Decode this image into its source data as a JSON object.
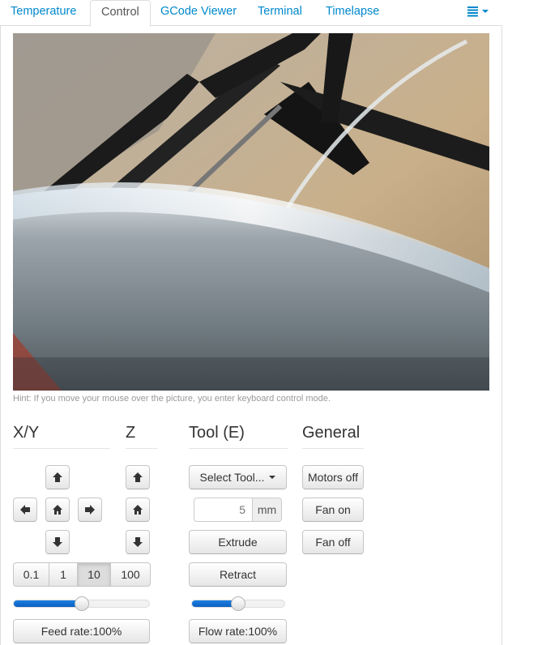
{
  "tabs": [
    {
      "label": "Temperature",
      "active": false
    },
    {
      "label": "Control",
      "active": true
    },
    {
      "label": "GCode Viewer",
      "active": false
    },
    {
      "label": "Terminal",
      "active": false
    },
    {
      "label": "Timelapse",
      "active": false
    }
  ],
  "tab_menu_icon": "list-icon",
  "hint": "Hint: If you move your mouse over the picture, you enter keyboard control mode.",
  "sections": {
    "xy": "X/Y",
    "z": "Z",
    "tool": "Tool (E)",
    "general": "General"
  },
  "xy_steps": [
    "0.1",
    "1",
    "10",
    "100"
  ],
  "xy_active_step": "10",
  "feed_rate": {
    "label": "Feed rate:100%",
    "value": 0.5
  },
  "flow_rate": {
    "label": "Flow rate:100%",
    "value": 0.5
  },
  "tool": {
    "select_label": "Select Tool...",
    "amount_placeholder": "5",
    "amount_unit": "mm",
    "extrude_label": "Extrude",
    "retract_label": "Retract"
  },
  "general": {
    "motors_off": "Motors off",
    "fan_on": "Fan on",
    "fan_off": "Fan off"
  },
  "colors": {
    "link": "#0088cc",
    "slider_fill": "#0b6fd4"
  }
}
